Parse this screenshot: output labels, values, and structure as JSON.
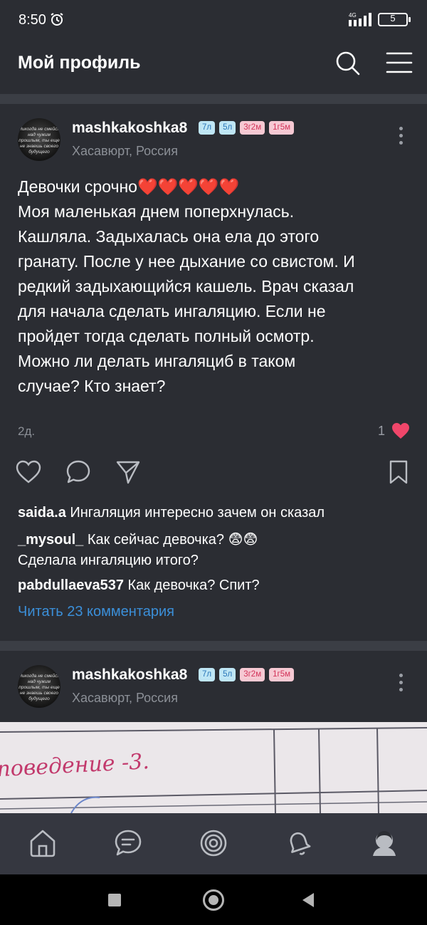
{
  "statusbar": {
    "time": "8:50",
    "network": "4G",
    "battery": "5"
  },
  "appbar": {
    "title": "Мой профиль"
  },
  "post1": {
    "author": "mashkakoshka8",
    "avatar_text": "Никогда не смейся над чужим прошлым, ты еще не знаешь своего будущего",
    "badges": [
      "7л",
      "5л",
      "3г2м",
      "1г5м"
    ],
    "location": "Хасавюрт, Россия",
    "text_lines": [
      "Девочки срочно❤️❤️❤️❤️❤️",
      "Моя маленькая днем поперхнулась.",
      "Кашляла. Задыхалась она ела до этого",
      "гранату. После у нее дыхание со свистом. И",
      "редкий задыхающийся кашель. Врач сказал",
      "для начала сделать ингаляцию. Если не",
      "пройдет тогда сделать полный осмотр.",
      "Можно ли делать ингаляциб в таком",
      "случае? Кто знает?"
    ],
    "date": "2д.",
    "likes": "1",
    "comments": [
      {
        "user": "saida.a",
        "text": "Ингаляция интересно зачем он сказал"
      },
      {
        "user": "_mysoul_",
        "text": "Как сейчас девочка? 😨😨",
        "text2": "Сделала ингаляцию итого?"
      },
      {
        "user": "pabdullaeva537",
        "text": "Как девочка? Спит?"
      }
    ],
    "read_more": "Читать 23 комментария"
  },
  "post2": {
    "author": "mashkakoshka8",
    "avatar_text": "Никогда не смейся над чужим прошлым, ты еще не знаешь своего будущего",
    "badges": [
      "7л",
      "5л",
      "3г2м",
      "1г5м"
    ],
    "location": "Хасавюрт, Россия",
    "image_text": "поведение -3."
  },
  "colors": {
    "background": "#2b2d33",
    "accent_link": "#3b8fd9",
    "heart": "#f0466a",
    "navbar": "#353740"
  }
}
